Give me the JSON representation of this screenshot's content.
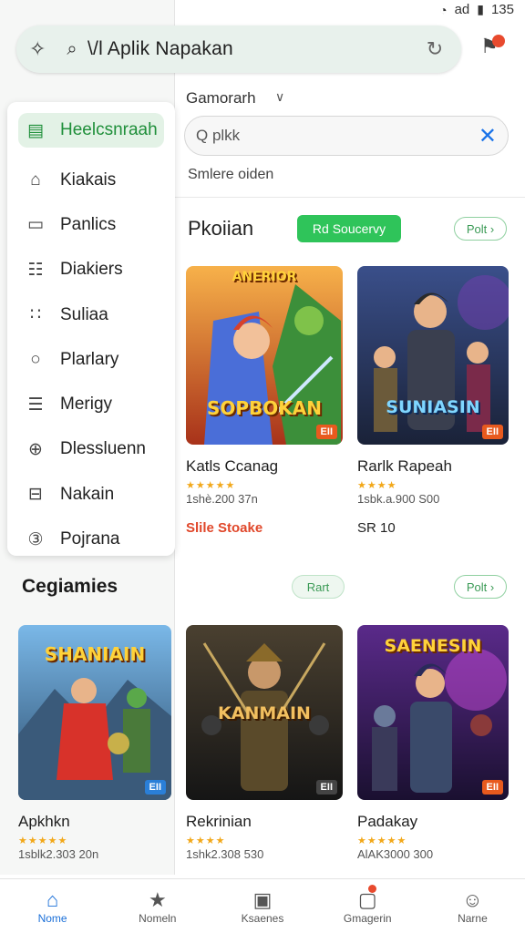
{
  "status": {
    "signal": "ad",
    "battery_icon": "battery-icon",
    "time": "135"
  },
  "search": {
    "query": "\\/l Aplik Napakan"
  },
  "drawer": {
    "items": [
      {
        "label": "Heelcsnraah",
        "icon": "app-icon",
        "glyph": "▤",
        "active": true
      },
      {
        "label": "Kiakais",
        "icon": "home-icon",
        "glyph": "⌂"
      },
      {
        "label": "Panlics",
        "icon": "tablet-icon",
        "glyph": "▭"
      },
      {
        "label": "Diakiers",
        "icon": "grid-icon",
        "glyph": "☷"
      },
      {
        "label": "Suliaa",
        "icon": "apps-icon",
        "glyph": "∷"
      },
      {
        "label": "Plarlary",
        "icon": "circle-icon",
        "glyph": "○"
      },
      {
        "label": "Merigy",
        "icon": "list-icon",
        "glyph": "☰"
      },
      {
        "label": "Dlessluenn",
        "icon": "plus-circle-icon",
        "glyph": "⊕"
      },
      {
        "label": "Nakain",
        "icon": "minus-box-icon",
        "glyph": "⊟"
      },
      {
        "label": "Pojrana",
        "icon": "number-circle-icon",
        "glyph": "③"
      }
    ]
  },
  "filter": {
    "label": "Gamorarh",
    "input": "Q plkk",
    "hint": "Smlere oiden"
  },
  "section1": {
    "title": "Pkoiian",
    "primary_button": "Rd Soucervy",
    "more_button": "Polt ›",
    "cards": [
      {
        "art_title_top": "ANERIOR",
        "art_title": "SOPBOKAN",
        "badge": "EII",
        "name": "Katls Ccanag",
        "stars": "★★★★★",
        "meta": "1shè.200  37n",
        "price": "Slile Stoake"
      },
      {
        "art_title_top": "",
        "art_title": "SUNIASIN",
        "badge": "EII",
        "name": "Rarlk Rapeah",
        "stars": "★★★★",
        "meta": "1sbk.a.900  S00",
        "price": "SR 10"
      }
    ]
  },
  "section2": {
    "title": "Cegiamies",
    "secondary_button": "Rart",
    "more_button": "Polt ›",
    "cards": [
      {
        "art_title": "SHANIAIN",
        "badge": "EII",
        "name": "Apkhkn",
        "stars": "★★★★★",
        "meta": "1sblk2.303  20n"
      },
      {
        "art_title": "KANMAIN",
        "badge": "EII",
        "name": "Rekrinian",
        "stars": "★★★★",
        "meta": "1shk2.308  530"
      },
      {
        "art_title": "SAENESIN",
        "badge": "EII",
        "name": "Padakay",
        "stars": "★★★★★",
        "meta": "AlAK3000  300"
      }
    ]
  },
  "bottom_nav": [
    {
      "label": "Nome",
      "icon": "home-icon",
      "glyph": "⌂",
      "active": true
    },
    {
      "label": "Nomeln",
      "icon": "map-icon",
      "glyph": "★"
    },
    {
      "label": "Ksaenes",
      "icon": "frame-icon",
      "glyph": "▣"
    },
    {
      "label": "Gmagerin",
      "icon": "notification-icon",
      "glyph": "▢",
      "dot": true
    },
    {
      "label": "Narne",
      "icon": "profile-icon",
      "glyph": "☺"
    }
  ]
}
